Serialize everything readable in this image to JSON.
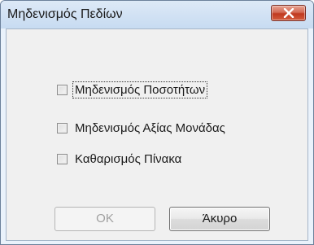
{
  "window": {
    "title": "Μηδενισμός Πεδίων",
    "close_icon": "close-x-icon"
  },
  "options": [
    {
      "label": "Μηδενισμός Ποσοτήτων",
      "checked": false,
      "focused": true
    },
    {
      "label": "Μηδενισμός Αξίας Μονάδας",
      "checked": false,
      "focused": false
    },
    {
      "label": "Καθαρισμός Πίνακα",
      "checked": false,
      "focused": false
    }
  ],
  "buttons": {
    "ok_label": "OK",
    "ok_enabled": false,
    "cancel_label": "Άκυρο",
    "cancel_enabled": true
  },
  "colors": {
    "close_button": "#c9452b",
    "client_background": "#f0f0f0"
  }
}
